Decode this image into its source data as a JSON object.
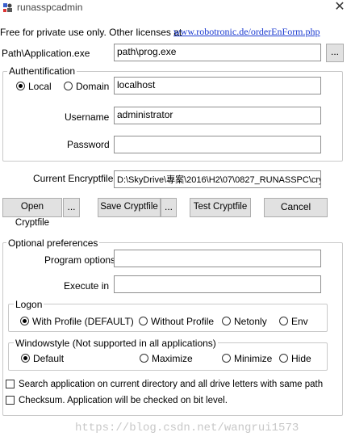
{
  "window": {
    "title": "runasspcadmin",
    "close_symbol": "✕"
  },
  "license": {
    "text": "Free for private use only. Other licenses at",
    "link": "www.robotronic.de/orderEnForm.php"
  },
  "path": {
    "label": "Path\\Application.exe",
    "value": "path\\prog.exe",
    "browse": "..."
  },
  "auth": {
    "legend": "Authentification",
    "local_label": "Local",
    "domain_label": "Domain",
    "domain_value": "localhost",
    "username_label": "Username",
    "username_value": "administrator",
    "password_label": "Password",
    "password_value": ""
  },
  "cryptfile": {
    "label": "Current Encryptfile",
    "value": "D:\\SkyDrive\\專案\\2016\\H2\\07\\0827_RUNASSPC\\cry"
  },
  "buttons": {
    "open": "Open Cryptfile",
    "open_dots": "...",
    "save": "Save Cryptfile",
    "save_dots": "...",
    "test": "Test Cryptfile",
    "cancel": "Cancel"
  },
  "optional": {
    "legend": "Optional preferences",
    "program_options_label": "Program options",
    "program_options_value": "",
    "execute_in_label": "Execute in",
    "execute_in_value": ""
  },
  "logon": {
    "legend": "Logon",
    "options": [
      "With Profile (DEFAULT)",
      "Without Profile",
      "Netonly",
      "Env"
    ],
    "selected": "With Profile (DEFAULT)"
  },
  "windowstyle": {
    "legend": "Windowstyle (Not supported in all applications)",
    "options": [
      "Default",
      "Maximize",
      "Minimize",
      "Hide"
    ],
    "selected": "Default"
  },
  "checks": {
    "search": "Search application on current directory and all drive letters with same path",
    "checksum": "Checksum. Application will be checked on bit level."
  },
  "watermark": "https://blog.csdn.net/wangrui1573"
}
